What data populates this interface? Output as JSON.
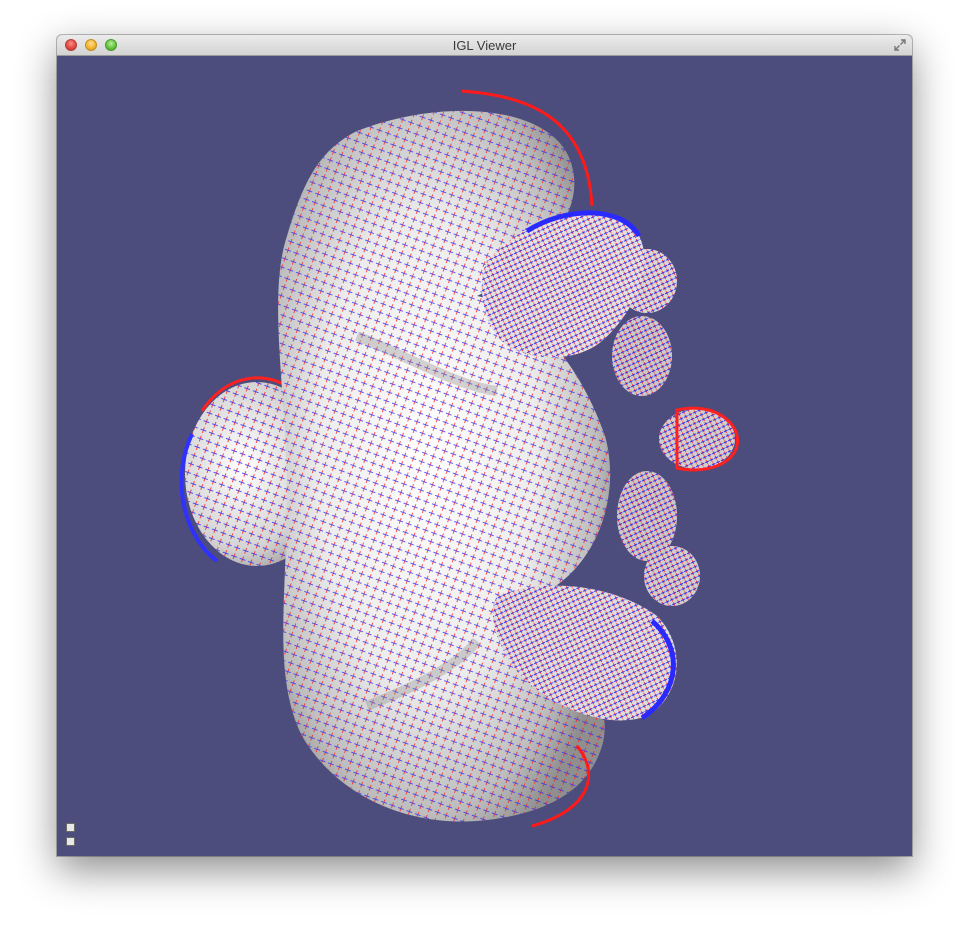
{
  "window": {
    "title": "IGL Viewer",
    "background_color": "#4c4c7d"
  },
  "controls": {
    "close": "close-button",
    "minimize": "minimize-button",
    "zoom": "zoom-button",
    "fullscreen_icon": "fullscreen-arrows-icon"
  },
  "viewport": {
    "model_colors": {
      "surface": "#f2f2f2",
      "max_direction": "#ff0000",
      "min_direction": "#0000ff"
    },
    "overlay_icons": [
      "expand-panel-icon",
      "settings-panel-icon"
    ]
  }
}
